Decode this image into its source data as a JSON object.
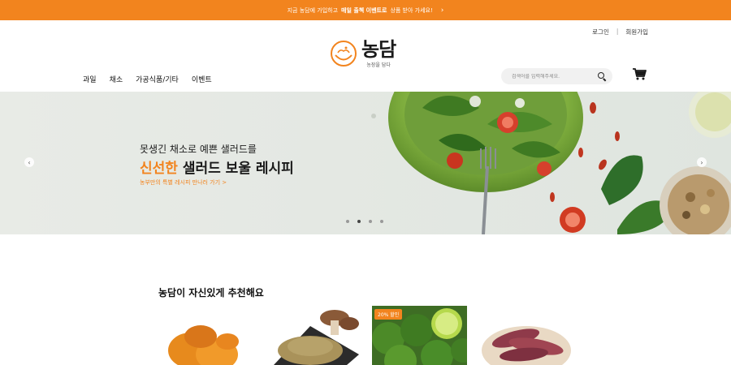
{
  "promo": {
    "prefix": "지금 농담에 가입하고",
    "highlight": "매일 출첵 이벤트로",
    "suffix": "상품 받아 가세요!",
    "chevron_icon": "chevron-right-icon"
  },
  "auth": {
    "login": "로그인",
    "separator": "|",
    "signup": "회원가입"
  },
  "logo": {
    "title": "농담",
    "subtitle": "농장을 담다"
  },
  "nav": {
    "items": [
      "과일",
      "채소",
      "가공식품/기타",
      "이벤트"
    ]
  },
  "search": {
    "placeholder": "검색어를 입력해주세요.",
    "icon": "search-icon"
  },
  "cart": {
    "icon": "cart-icon"
  },
  "hero": {
    "line1": "못생긴 채소로 예쁜 샐러드를",
    "line2_accent": "신선한",
    "line2_rest": " 샐러드 보울 레시피",
    "link": "농부만의 특별 레시피 만나러 가기 >",
    "arrow_left": "‹",
    "arrow_right": "›",
    "slide_count": 4,
    "active_slide": 2
  },
  "recommend": {
    "title": "농담이 자신있게 추천해요",
    "products": [
      {
        "image": "dried-persimmon"
      },
      {
        "image": "mushroom-powder"
      },
      {
        "image": "limes",
        "badge": "20% 할인"
      },
      {
        "image": "sweet-potatoes"
      }
    ]
  },
  "colors": {
    "brand": "#f2841e"
  }
}
